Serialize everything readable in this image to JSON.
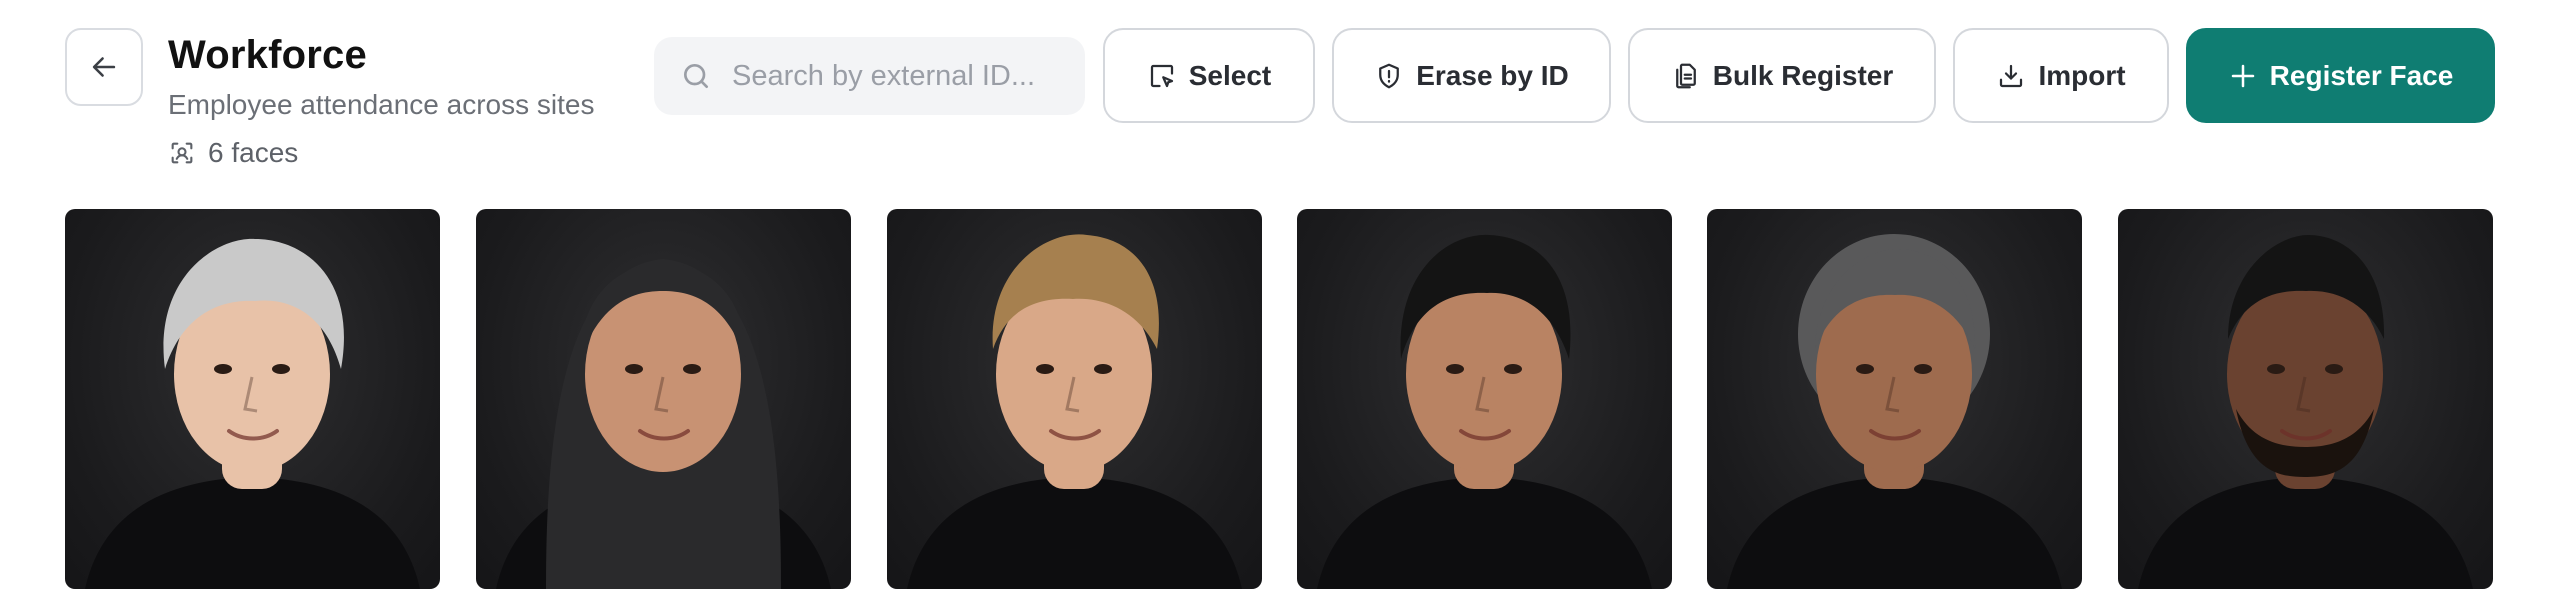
{
  "header": {
    "title": "Workforce",
    "subtitle": "Employee attendance across sites",
    "face_count": "6 faces"
  },
  "search": {
    "placeholder": "Search by external ID...",
    "value": ""
  },
  "toolbar": {
    "select_label": "Select",
    "erase_label": "Erase by ID",
    "bulk_register_label": "Bulk Register",
    "import_label": "Import",
    "register_face_label": "Register Face"
  },
  "colors": {
    "accent": "#0f7d72",
    "card_background": "#1c1c1e"
  },
  "icons": {
    "back": "arrow-left-icon",
    "count": "face-scan-icon",
    "search": "search-icon",
    "select": "select-square-icon",
    "erase": "shield-alert-icon",
    "bulk_register": "files-icon",
    "import": "download-icon",
    "register_face": "plus-icon"
  },
  "faces": [
    {
      "hair": "#c9c9c9",
      "skin": "#e8c2a8",
      "style": "short-gray"
    },
    {
      "hair": "#2a2a2c",
      "skin": "#c89273",
      "style": "hijab"
    },
    {
      "hair": "#a6804f",
      "skin": "#d9a888",
      "style": "short-blond"
    },
    {
      "hair": "#141414",
      "skin": "#b98363",
      "style": "short-dark"
    },
    {
      "hair": "#59595a",
      "skin": "#9e6b4e",
      "style": "pulled-back"
    },
    {
      "hair": "#141414",
      "skin": "#6a4230",
      "style": "buzz-beard"
    }
  ]
}
